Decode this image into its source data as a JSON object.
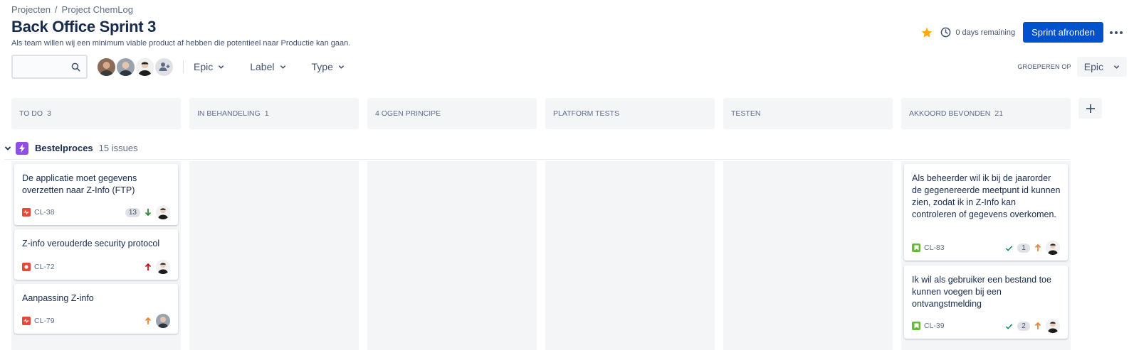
{
  "breadcrumb": [
    "Projecten",
    "/",
    "Project ChemLog"
  ],
  "page": {
    "title": "Back Office Sprint 3",
    "subtitle": "Als team willen wij een minimum viable product af hebben die potentieel naar Productie kan gaan."
  },
  "header": {
    "remaining": "0 days remaining",
    "complete_button": "Sprint afronden",
    "starred": true
  },
  "filters": {
    "search_placeholder": "",
    "dropdowns": [
      "Epic",
      "Label",
      "Type"
    ],
    "groupby_label": "GROEPEREN OP",
    "groupby_value": "Epic"
  },
  "columns": [
    {
      "name": "TO DO",
      "count": "3"
    },
    {
      "name": "IN BEHANDELING",
      "count": "1"
    },
    {
      "name": "4 OGEN PRINCIPE",
      "count": ""
    },
    {
      "name": "PLATFORM TESTS",
      "count": ""
    },
    {
      "name": "TESTEN",
      "count": ""
    },
    {
      "name": "AKKOORD BEVONDEN",
      "count": "21"
    }
  ],
  "swimlane": {
    "title": "Bestelproces",
    "count": "15 issues"
  },
  "cards": {
    "todo": [
      {
        "title": "De applicatie moet gegevens overzetten naar Z-Info (FTP)",
        "key": "CL-38",
        "type": "bug",
        "points": "13",
        "priority": "low"
      },
      {
        "title": "Z-info verouderde security protocol",
        "key": "CL-72",
        "type": "blocker",
        "points": "",
        "priority": "highest"
      },
      {
        "title": "Aanpassing Z-info",
        "key": "CL-79",
        "type": "bug",
        "points": "",
        "priority": "medium"
      }
    ],
    "done": [
      {
        "title": "Als beheerder wil ik bij de jaarorder de gegenereerde meetpunt id kunnen zien, zodat ik in Z-Info kan controleren of gegevens overkomen.",
        "key": "CL-83",
        "type": "story",
        "points": "1",
        "priority": "medium"
      },
      {
        "title": "Ik wil als gebruiker een bestand toe kunnen voegen bij een ontvangstmelding",
        "key": "CL-39",
        "type": "story",
        "points": "2",
        "priority": "medium"
      }
    ]
  },
  "colors": {
    "primary": "#0052cc",
    "epic": "#904ee2",
    "bug": "#e5493a",
    "story": "#63ba3c",
    "star": "#ffab00"
  }
}
